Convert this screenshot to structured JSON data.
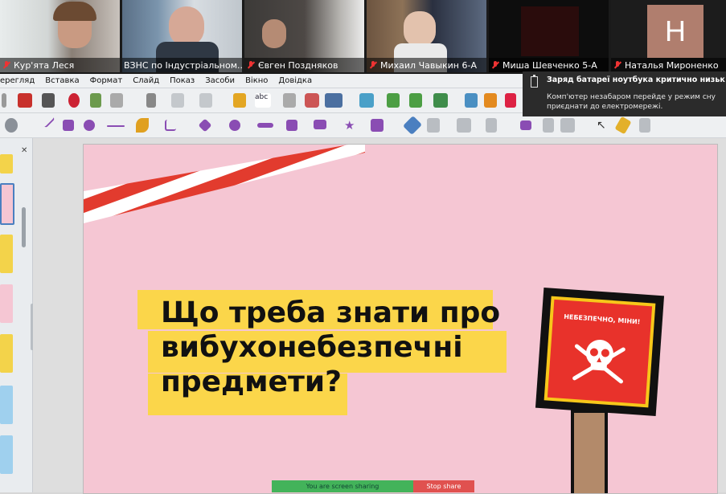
{
  "participants": [
    {
      "name": "Кур'ята Леся",
      "muted": true
    },
    {
      "name": "ВЗНС по Індустріальном...",
      "muted": false
    },
    {
      "name": "Євген Поздняков",
      "muted": true
    },
    {
      "name": "Михаил Чавыкин 6-А",
      "muted": true
    },
    {
      "name": "Миша Шевченко 5-А",
      "muted": true
    },
    {
      "name": "Наталья Мироненко",
      "muted": true
    }
  ],
  "avatar_letter": "Н",
  "menu": [
    "ерегляд",
    "Вставка",
    "Формат",
    "Слайд",
    "Показ",
    "Засоби",
    "Вікно",
    "Довідка"
  ],
  "notification": {
    "title": "Заряд батареї ноутбука критично низьк",
    "message": "Комп'ютер незабаром перейде у режим сну приєднати до електромережі."
  },
  "slide": {
    "title": "Що треба знати про\nвибухонебезпечні\nпредмети?",
    "sign_text": "НЕБЕЗПЕЧНО, МІНИ!"
  },
  "screen_share": {
    "status": "You are screen sharing",
    "stop_label": "Stop share"
  },
  "colors": {
    "slide_bg": "#f5c6d3",
    "highlight": "#fbd64a",
    "sign_red": "#e8322b",
    "tape_red": "#e23b2e",
    "share_green": "#43b35a",
    "stop_red": "#e0514f"
  }
}
